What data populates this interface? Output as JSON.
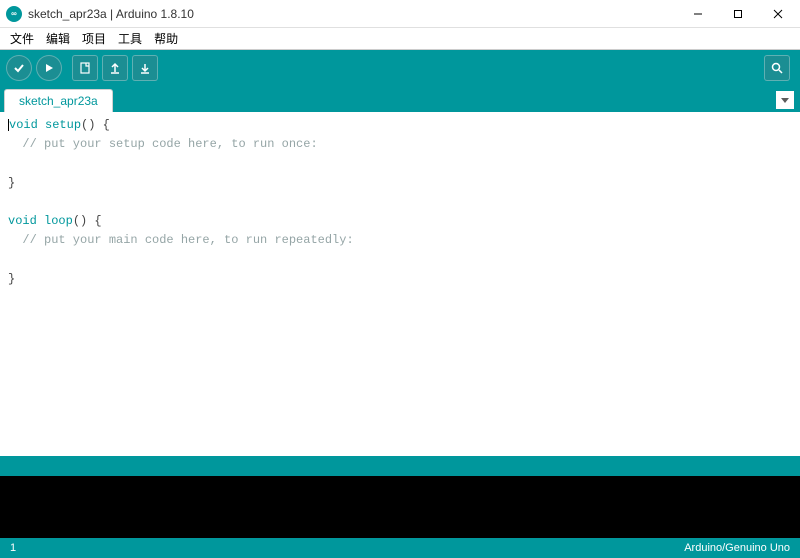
{
  "window": {
    "title": "sketch_apr23a | Arduino 1.8.10",
    "logo_text": "∞"
  },
  "menu": {
    "file": "文件",
    "edit": "编辑",
    "project": "项目",
    "tools": "工具",
    "help": "帮助"
  },
  "tab": {
    "name": "sketch_apr23a"
  },
  "code": {
    "l1_kw": "void",
    "l1_fn": " setup",
    "l1_rest": "() {",
    "l2": "  // put your setup code here, to run once:",
    "l3": "",
    "l4": "}",
    "l5": "",
    "l6_kw": "void",
    "l6_fn": " loop",
    "l6_rest": "() {",
    "l7": "  // put your main code here, to run repeatedly:",
    "l8": "",
    "l9": "}"
  },
  "status": {
    "line": "1",
    "board": "Arduino/Genuino Uno"
  }
}
